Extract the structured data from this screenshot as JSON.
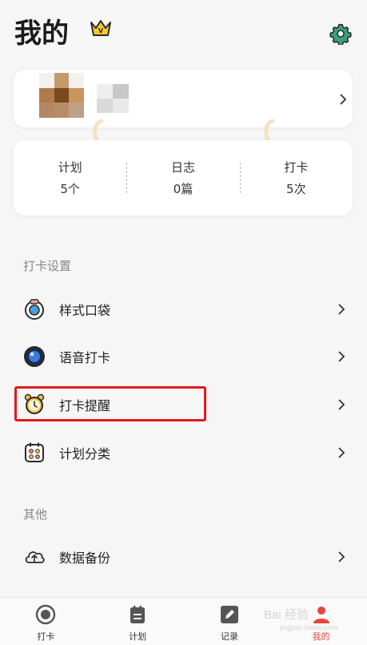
{
  "header": {
    "title": "我的",
    "vip_badge_letter": "V"
  },
  "stats": [
    {
      "label": "计划",
      "value": "5个"
    },
    {
      "label": "日志",
      "value": "0篇"
    },
    {
      "label": "打卡",
      "value": "5次"
    }
  ],
  "sections": {
    "checkin_settings": {
      "title": "打卡设置",
      "items": [
        {
          "label": "样式口袋",
          "icon": "style-pocket-icon"
        },
        {
          "label": "语音打卡",
          "icon": "voice-checkin-icon"
        },
        {
          "label": "打卡提醒",
          "icon": "alarm-clock-icon"
        },
        {
          "label": "计划分类",
          "icon": "calendar-grid-icon"
        }
      ]
    },
    "other": {
      "title": "其他",
      "items": [
        {
          "label": "数据备份",
          "icon": "cloud-backup-icon"
        }
      ]
    }
  },
  "tabbar": {
    "active": "我的",
    "tabs": [
      {
        "label": "打卡",
        "icon": "record-circle-icon"
      },
      {
        "label": "计划",
        "icon": "clipboard-icon"
      },
      {
        "label": "记录",
        "icon": "edit-note-icon"
      },
      {
        "label": "我的",
        "icon": "person-icon"
      }
    ]
  },
  "watermark": {
    "main": "Bai 经验",
    "sub": "jingyan.baidu.com"
  },
  "colors": {
    "accent_red": "#e8483c",
    "highlight_border": "#e3191c",
    "vip_gold": "#f5c82c",
    "settings_green": "#3aa17e"
  }
}
